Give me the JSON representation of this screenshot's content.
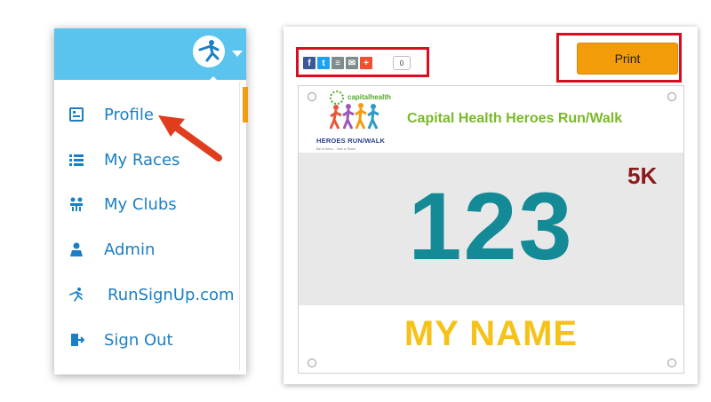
{
  "menu": {
    "items": [
      {
        "label": "Profile",
        "icon": "profile-card-icon"
      },
      {
        "label": "My Races",
        "icon": "list-icon"
      },
      {
        "label": "My Clubs",
        "icon": "clubs-icon"
      },
      {
        "label": "Admin",
        "icon": "admin-icon"
      },
      {
        "label": "RunSignUp.com",
        "icon": "runner-icon"
      },
      {
        "label": "Sign Out",
        "icon": "sign-out-icon"
      }
    ],
    "header_color": "#5bc4ee",
    "label_color": "#1a7fc4"
  },
  "share": {
    "buttons": [
      "facebook-icon",
      "twitter-icon",
      "print-share-icon",
      "email-icon",
      "plus-icon"
    ],
    "count": "0"
  },
  "print_label": "Print",
  "bib": {
    "logo_text": "capitalhealth",
    "logo_heroes": "HEROES RUN/WALK",
    "logo_tagline": "Be a Hero... Join a Team",
    "title": "Capital Health Heroes Run/Walk",
    "distance": "5K",
    "number": "123",
    "name": "MY NAME",
    "colors": {
      "title": "#7ab929",
      "number": "#138a96",
      "distance": "#8b1a1a",
      "name": "#f6c21a"
    }
  }
}
